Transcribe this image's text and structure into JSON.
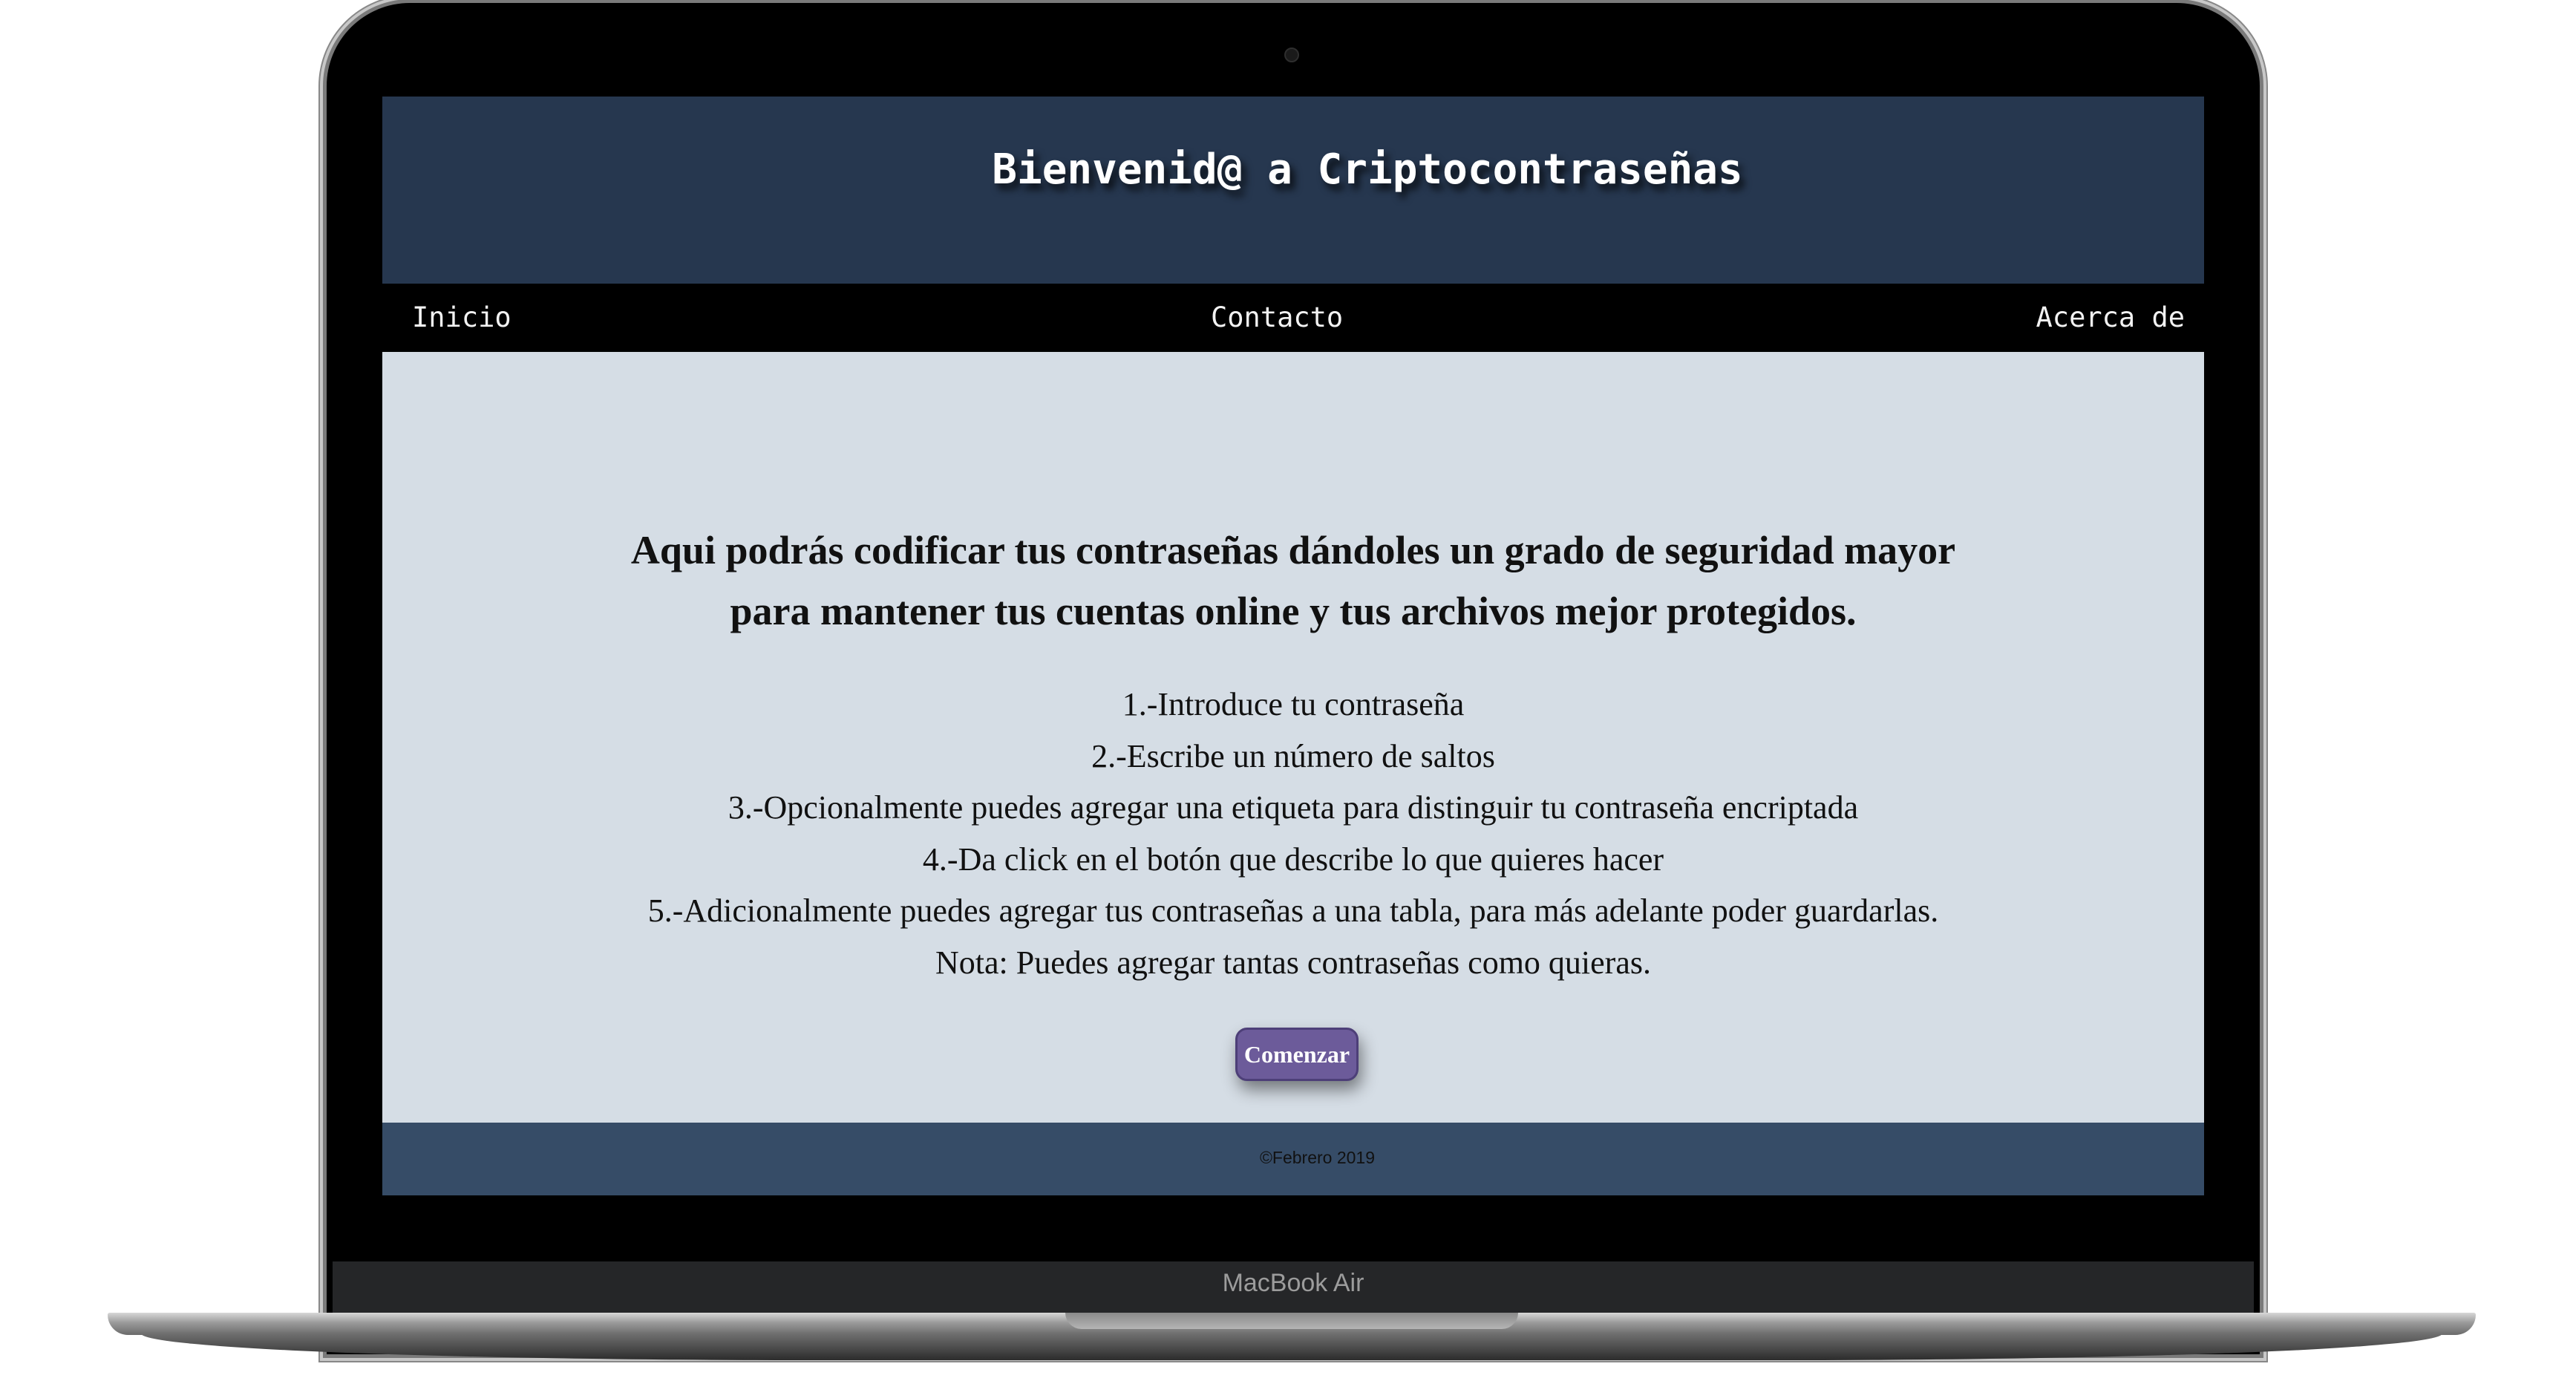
{
  "device": {
    "model_label": "MacBook Air"
  },
  "header": {
    "title": "Bienvenid@ a Criptocontraseñas"
  },
  "nav": {
    "items": [
      {
        "label": "Inicio"
      },
      {
        "label": "Contacto"
      },
      {
        "label": "Acerca de"
      }
    ]
  },
  "main": {
    "intro_line1": "Aqui podrás codificar tus contraseñas dándoles un grado de seguridad mayor",
    "intro_line2": "para mantener tus cuentas online y tus archivos mejor protegidos.",
    "steps": [
      "1.-Introduce tu contraseña",
      "2.-Escribe un número de saltos",
      "3.-Opcionalmente puedes agregar una etiqueta para distinguir tu contraseña encriptada",
      "4.-Da click en el botón que describe lo que quieres hacer",
      "5.-Adicionalmente puedes agregar tus contraseñas a una tabla, para más adelante poder guardarlas.",
      "Nota: Puedes agregar tantas contraseñas como quieras."
    ],
    "start_button_label": "Comenzar"
  },
  "footer": {
    "copyright": "©Febrero 2019"
  },
  "colors": {
    "header_bg": "#26374f",
    "nav_bg": "#000000",
    "main_bg": "#d5dde5",
    "footer_bg": "#364c67",
    "button_bg": "#6c5b9a"
  }
}
